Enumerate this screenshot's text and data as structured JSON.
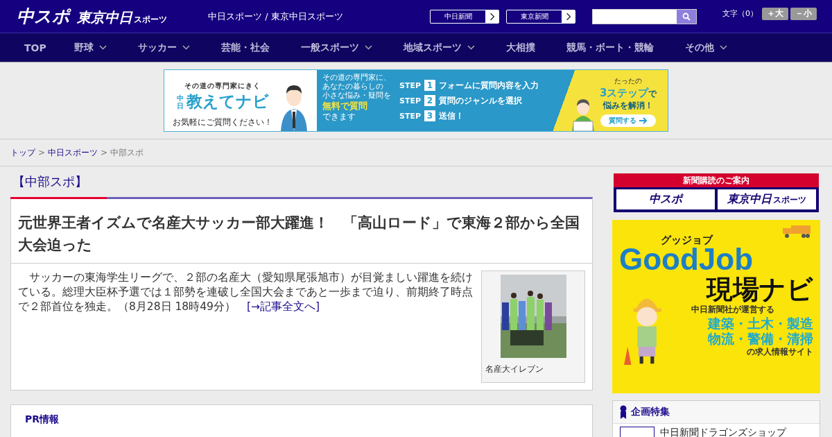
{
  "header": {
    "logo_main": "中スポ",
    "logo_sub": "東京中日",
    "logo_sub_small": "スポーツ",
    "site_title": "中日スポーツ / 東京中日スポーツ",
    "paper_links": [
      "中日新聞",
      "東京新聞"
    ],
    "font_size": {
      "label": "文字（0）",
      "buttons": [
        "＋大",
        "－小"
      ]
    }
  },
  "nav": [
    {
      "label": "TOP",
      "dropdown": false
    },
    {
      "label": "野球",
      "dropdown": true
    },
    {
      "label": "サッカー",
      "dropdown": true
    },
    {
      "label": "芸能・社会",
      "dropdown": false
    },
    {
      "label": "一般スポーツ",
      "dropdown": true
    },
    {
      "label": "地域スポーツ",
      "dropdown": true
    },
    {
      "label": "大相撲",
      "dropdown": false
    },
    {
      "label": "競馬・ボート・競輪",
      "dropdown": false
    },
    {
      "label": "その他",
      "dropdown": true
    }
  ],
  "top_banner": {
    "tagline": "その道の専門家にきく",
    "brand_small": "中日",
    "brand": "教えてナビ",
    "note": "お気軽にご質問ください！",
    "intro": [
      "その道の専門家に、",
      "あなたの暮らしの",
      "小さな悩み・疑問を"
    ],
    "highlight": "無料で質問",
    "intro_end": "できます",
    "steps": [
      {
        "label": "STEP",
        "number": "1",
        "text": "フォームに質問内容を入力"
      },
      {
        "label": "STEP",
        "number": "2",
        "text": "質問のジャンルを選択"
      },
      {
        "label": "STEP",
        "number": "3",
        "text": "送信！"
      }
    ],
    "promo_small": "たったの",
    "promo_big": "3ステップ",
    "promo_end": "で",
    "promo_line2": "悩みを解消！",
    "cta": "質問する"
  },
  "breadcrumb": [
    {
      "label": "トップ",
      "link": true
    },
    {
      "label": "中日スポーツ",
      "link": true
    },
    {
      "label": "中部スポ",
      "link": false
    }
  ],
  "breadcrumb_separator": ">",
  "section_title": "【中部スポ】",
  "article": {
    "headline": "元世界王者イズムで名産大サッカー部大躍進！　「高山ロード」で東海２部から全国大会迫った",
    "body": "　サッカーの東海学生リーグで、２部の名産大（愛知県尾張旭市）が目覚ましい躍進を続けている。総理大臣杯予選では１部勢を連破し全国大会まであと一歩まで迫り、前期終了時点で２部首位を独走。（8月28日 18時49分）",
    "more_link": "[→記事全文へ]",
    "photo_caption": "名産大イレブン"
  },
  "pr": {
    "title": "PR情報"
  },
  "sidebar": {
    "subscribe_title": "新聞購読のご案内",
    "subscribe_logos": [
      {
        "main": "中スポ"
      },
      {
        "main": "東京中日",
        "small": "スポーツ"
      }
    ],
    "job_ad": {
      "kana": "グッジョブ",
      "brand": "GoodJob",
      "title": "現場ナビ",
      "line1": "中日新聞社が運営する",
      "fields": [
        "建築・土木・製造",
        "物流・警備・清掃"
      ],
      "line_end": "の求人情報サイト"
    },
    "feature_title": "企画特集",
    "feature_items": [
      "中日新聞ドラゴンズショップ"
    ]
  }
}
